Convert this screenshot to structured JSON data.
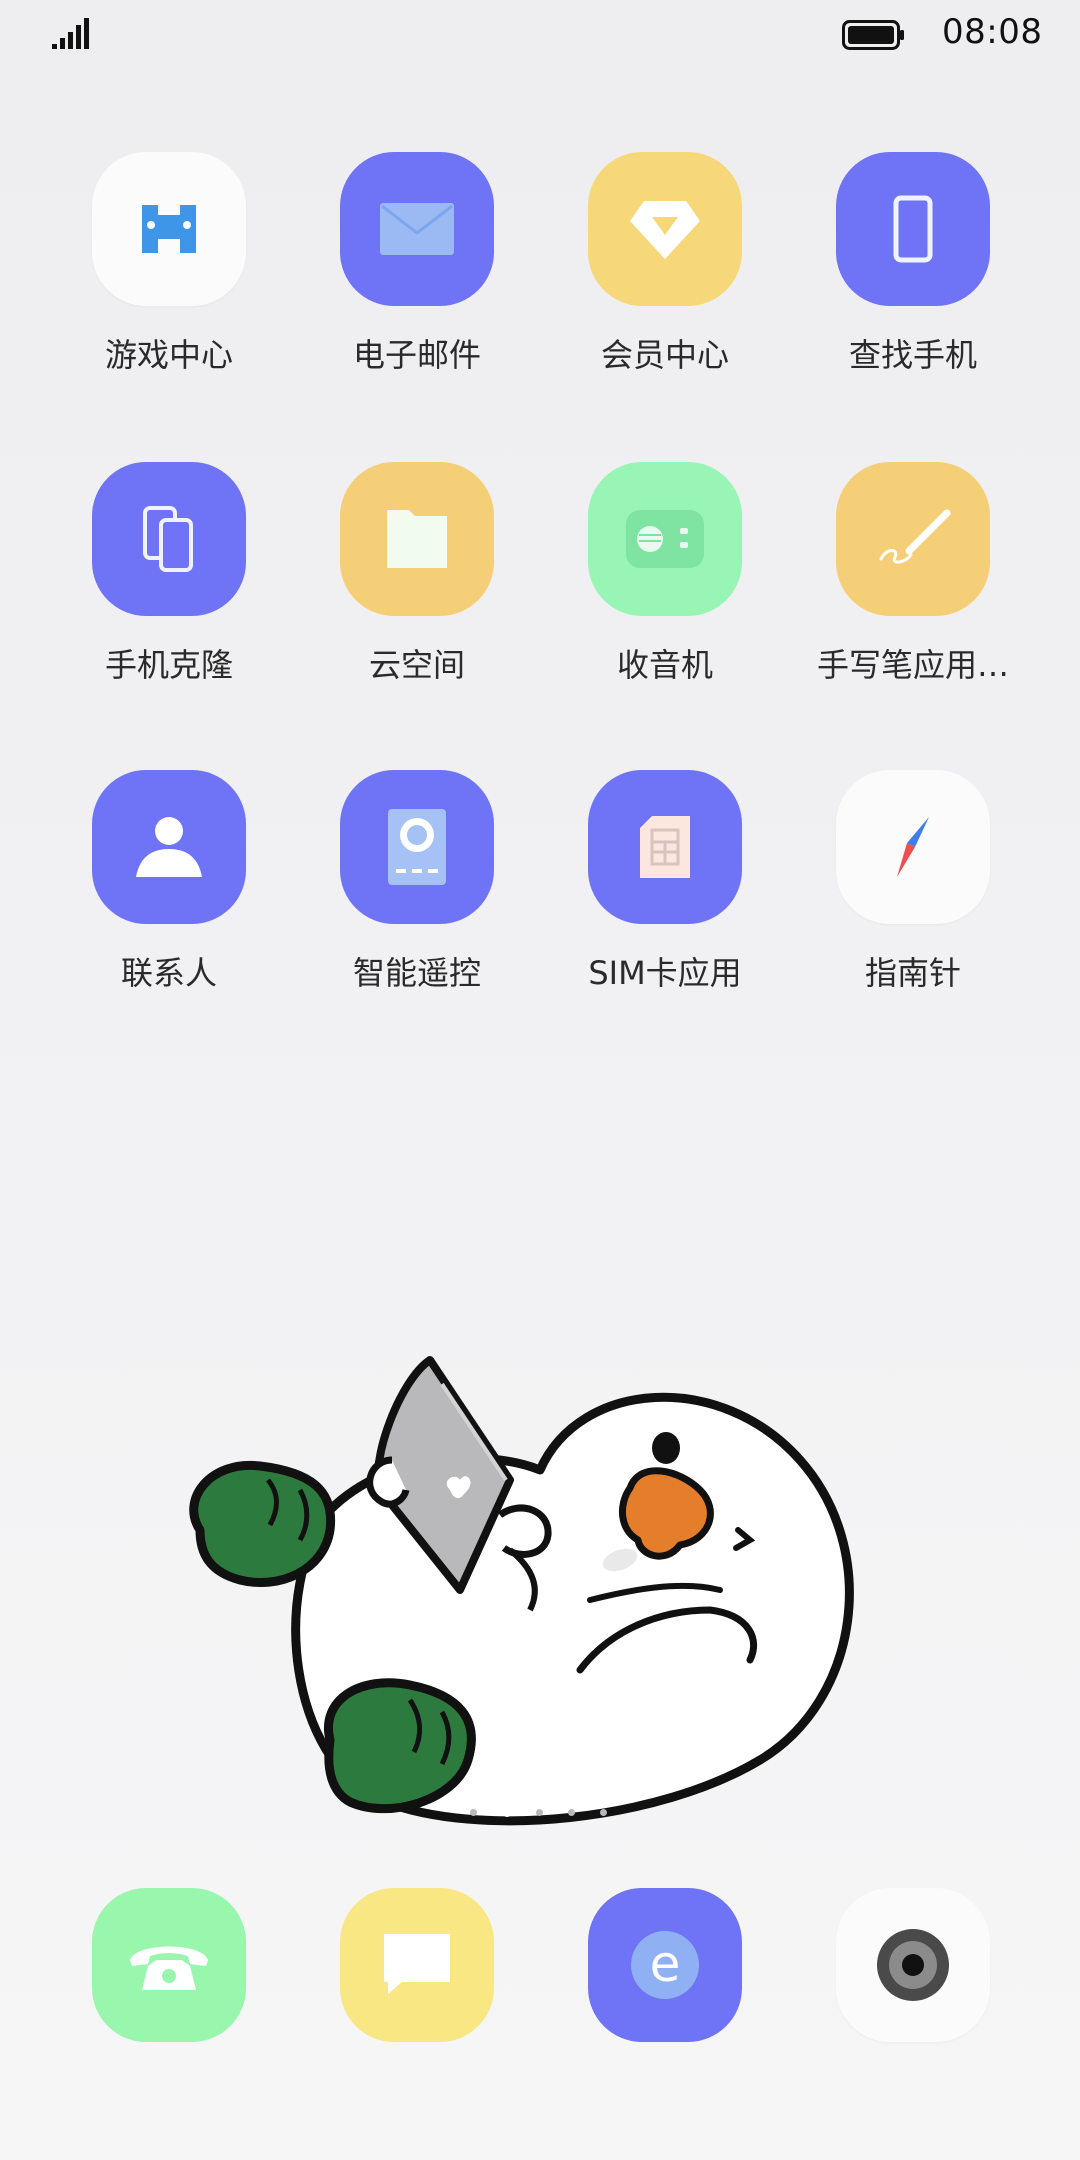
{
  "status_bar": {
    "time": "08:08",
    "signal_icon": "signal-bars-icon",
    "battery_icon": "battery-full-icon"
  },
  "apps": [
    {
      "label": "游戏中心",
      "icon": "gamepad-icon",
      "color": "#fbfbfb"
    },
    {
      "label": "电子邮件",
      "icon": "mail-icon",
      "color": "#6f73f5"
    },
    {
      "label": "会员中心",
      "icon": "diamond-icon",
      "color": "#f6d87a"
    },
    {
      "label": "查找手机",
      "icon": "phone-outline-icon",
      "color": "#6f73f5"
    },
    {
      "label": "手机克隆",
      "icon": "phone-clone-icon",
      "color": "#6f73f5"
    },
    {
      "label": "云空间",
      "icon": "folder-icon",
      "color": "#f5cf78"
    },
    {
      "label": "收音机",
      "icon": "radio-icon",
      "color": "#98f5b6"
    },
    {
      "label": "手写笔应用…",
      "icon": "stylus-pen-icon",
      "color": "#f5cf78"
    },
    {
      "label": "联系人",
      "icon": "person-icon",
      "color": "#6f73f5"
    },
    {
      "label": "智能遥控",
      "icon": "remote-control-icon",
      "color": "#6f73f5"
    },
    {
      "label": "SIM卡应用",
      "icon": "sim-card-icon",
      "color": "#6f73f5"
    },
    {
      "label": "指南针",
      "icon": "compass-icon",
      "color": "#fbfbfb"
    }
  ],
  "page_indicator": {
    "pages": 5,
    "current": 2
  },
  "dock": [
    {
      "icon": "phone-handset-icon",
      "color": "#99f6ad"
    },
    {
      "icon": "message-bubble-icon",
      "color": "#f8e783"
    },
    {
      "icon": "browser-e-icon",
      "color": "#6f73f5"
    },
    {
      "icon": "camera-lens-icon",
      "color": "#fbfbfb"
    }
  ]
}
